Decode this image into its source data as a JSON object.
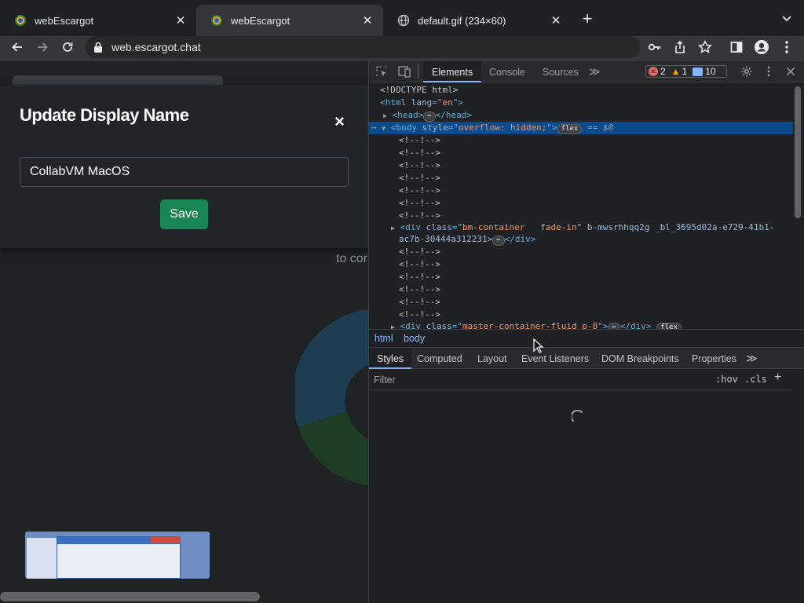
{
  "browser": {
    "tabs": [
      {
        "title": "webEscargot",
        "icon": "escargot-favicon-icon",
        "active": false
      },
      {
        "title": "webEscargot",
        "icon": "escargot-favicon-icon",
        "active": true
      },
      {
        "title": "default.gif (234×60)",
        "icon": "globe-icon",
        "active": false
      }
    ],
    "url": "web.escargot.chat"
  },
  "modal": {
    "title": "Update Display Name",
    "close_glyph": "×",
    "display_name_value": "CollabVM MacOS",
    "save_label": "Save"
  },
  "page": {
    "background_text": "to cor"
  },
  "devtools": {
    "tabs": [
      "Elements",
      "Console",
      "Sources"
    ],
    "more_glyph": "≫",
    "counts": {
      "errors": "2",
      "warnings": "1",
      "info": "10"
    },
    "dom": {
      "l0": "<!DOCTYPE html>",
      "l1_open": "<html ",
      "l1_attr": "lang",
      "l1_eq": "=\"",
      "l1_val": "en",
      "l1_close": "\">",
      "l2_tag": "<head>",
      "l2_end": "</head>",
      "l3_tag": "<body ",
      "l3_attr": "style",
      "l3_eq": "=\"",
      "l3_val": "overflow: hidden;",
      "l3_close": "\">",
      "l3_pill": "flex",
      "l3_ref": "== $0",
      "comment": "<!--!-->",
      "div1_open": "<div ",
      "div1_attr": "class",
      "div1_eq": "=\"",
      "div1_val": "bm-container   fade-in",
      "div1_rest": "\" b-mwsrhhqq2g _bl_3695d02a-e729-41b1-",
      "div1_line2": "ac7b-30444a312231>",
      "div1_end": "</div>",
      "div2_open": "<div ",
      "div2_attr": "class",
      "div2_eq": "=\"",
      "div2_val": "master-container-fluid p-0",
      "div2_close": "\">",
      "div2_end": "</div>",
      "div2_pill": "flex",
      "ellipsis": "⋯"
    },
    "breadcrumb": [
      "html",
      "body"
    ],
    "styles_tabs": [
      "Styles",
      "Computed",
      "Layout",
      "Event Listeners",
      "DOM Breakpoints",
      "Properties"
    ],
    "filter_placeholder": "Filter",
    "hov": ":hov",
    "cls": ".cls",
    "plus": "+"
  },
  "colors": {
    "accent_blue": "#8ab4f8",
    "save_green": "#198754",
    "selection": "#0b4a8b"
  }
}
